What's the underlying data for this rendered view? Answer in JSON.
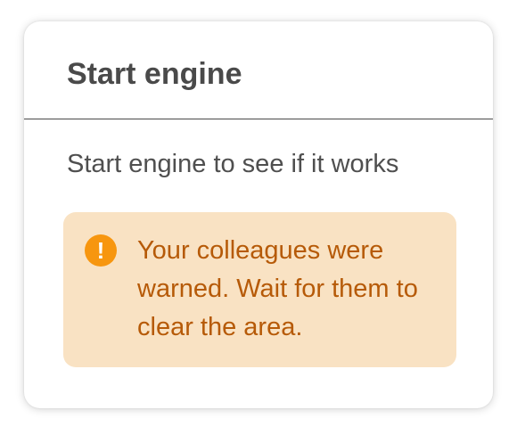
{
  "dialog": {
    "title": "Start engine",
    "message": "Start engine to see if it works"
  },
  "warning": {
    "icon": "exclamation-circle-icon",
    "icon_glyph": "!",
    "text": "Your colleagues were warned. Wait for them to clear the area.",
    "icon_color": "#f7960f",
    "text_color": "#b65a08",
    "background_color": "#f9e2c3"
  }
}
